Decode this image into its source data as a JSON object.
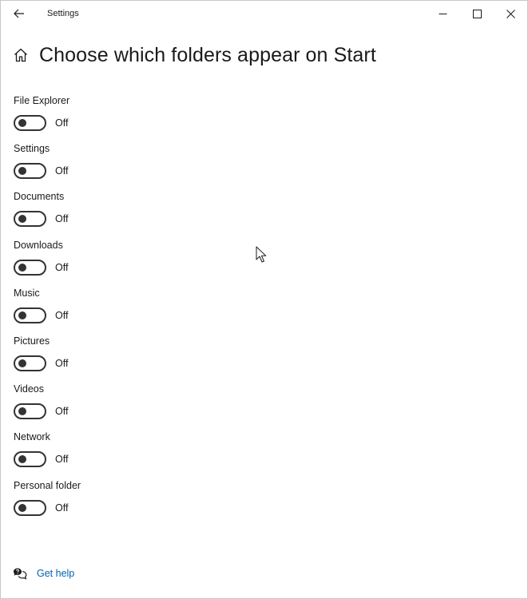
{
  "window": {
    "title": "Settings"
  },
  "header": {
    "title": "Choose which folders appear on Start"
  },
  "settings": [
    {
      "label": "File Explorer",
      "state": "Off",
      "on": false
    },
    {
      "label": "Settings",
      "state": "Off",
      "on": false
    },
    {
      "label": "Documents",
      "state": "Off",
      "on": false
    },
    {
      "label": "Downloads",
      "state": "Off",
      "on": false
    },
    {
      "label": "Music",
      "state": "Off",
      "on": false
    },
    {
      "label": "Pictures",
      "state": "Off",
      "on": false
    },
    {
      "label": "Videos",
      "state": "Off",
      "on": false
    },
    {
      "label": "Network",
      "state": "Off",
      "on": false
    },
    {
      "label": "Personal folder",
      "state": "Off",
      "on": false
    }
  ],
  "help": {
    "link": "Get help"
  },
  "icons": {
    "back": "arrow-left-icon",
    "minimize": "minimize-icon",
    "maximize": "maximize-icon",
    "close": "close-icon",
    "home": "home-icon",
    "help": "help-chat-icon"
  },
  "colors": {
    "toggle_off": "#333333",
    "link": "#0063b1",
    "text": "#1a1a1a"
  }
}
